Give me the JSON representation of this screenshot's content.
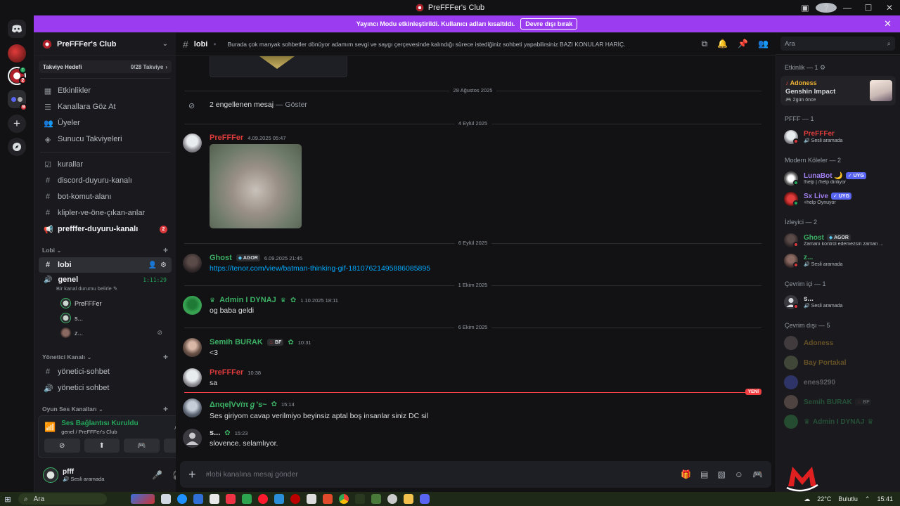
{
  "window": {
    "title": "PreFFFer's Club"
  },
  "banner": {
    "text": "Yayıncı Modu etkinleştirildi. Kullanıcı adları kısaltıldı.",
    "button": "Devre dışı bırak"
  },
  "sidebar": {
    "server_name": "PreFFFer's Club",
    "boost_label": "Takviye Hedefi",
    "boost_value": "0/28 Takviye",
    "nav": [
      {
        "label": "Etkinlikler",
        "icon": "calendar-icon"
      },
      {
        "label": "Kanallara Göz At",
        "icon": "browse-channels-icon"
      },
      {
        "label": "Üyeler",
        "icon": "members-icon"
      },
      {
        "label": "Sunucu Takviyeleri",
        "icon": "boost-icon"
      }
    ],
    "channels": [
      {
        "label": "kurallar",
        "icon": "rules-icon"
      },
      {
        "label": "discord-duyuru-kanalı",
        "icon": "hash-icon"
      },
      {
        "label": "bot-komut-alanı",
        "icon": "hash-icon"
      },
      {
        "label": "klipler-ve-öne-çıkan-anlar",
        "icon": "hash-icon"
      },
      {
        "label": "prefffer-duyuru-kanalı",
        "icon": "megaphone-icon",
        "badge": "2"
      }
    ],
    "category_lobi": "Lobi",
    "active_channel": "lobi",
    "voice_channel": {
      "name": "genel",
      "timer": "1:11:29",
      "status": "Bir kanal durumu belirle",
      "users": [
        "PreFFFer",
        "s...",
        "z..."
      ]
    },
    "category_admin": "Yönetici Kanalı",
    "admin_channels": [
      "yönetici-sohbet",
      "yönetici sohbet"
    ],
    "category_voice": "Oyun Ses Kanalları"
  },
  "voice_panel": {
    "title": "Ses Bağlantısı Kuruldu",
    "subtitle": "genel / PreFFFer's Club"
  },
  "user_panel": {
    "name": "pfff",
    "status": "Sesli aramada"
  },
  "chat": {
    "channel": "lobi",
    "topic": "Burada çok manyak sohbetler dönüyor adamım sevgi ve saygı çerçevesinde kalındığı sürece istediğiniz sohbeti yapabilirsiniz BAZI KONULAR HARİÇ.",
    "dividers": [
      "28 Ağustos 2025",
      "4 Eylül 2025",
      "6 Eylül 2025",
      "1 Ekim 2025",
      "6 Ekim 2025"
    ],
    "blocked_text": "2 engellenen mesaj",
    "blocked_show": "Göster",
    "messages": [
      {
        "author": "PreFFFer",
        "time": "4.09.2025 05:47",
        "body": ""
      },
      {
        "author": "Ghost",
        "tag": "AGOR",
        "time": "6.09.2025 21:45",
        "body": "https://tenor.com/view/batman-thinking-gif-18107621495886085895"
      },
      {
        "author": "Admin I DYNAJ",
        "time": "1.10.2025 18:11",
        "body": "og baba geldi"
      },
      {
        "author": "Semih BURAK",
        "tag": "BF",
        "time": "10:31",
        "body": "<3"
      },
      {
        "author": "PreFFFer",
        "time": "10:38",
        "body": "sa"
      },
      {
        "author": "ΔnqeļVvïπℊ's~",
        "time": "15:14",
        "body": "Ses giriyom cavap verilmiyo beyinsiz aptal boş insanlar siniz DC sil"
      },
      {
        "author": "s...",
        "time": "15:23",
        "body": "slovence. selamlıyor."
      }
    ],
    "new_label": "YENİ",
    "composer_placeholder": "#lobi kanalına mesaj gönder"
  },
  "search": {
    "placeholder": "Ara"
  },
  "members": {
    "activity_header": "Etkinlik — 1",
    "activity": {
      "name": "Adoness",
      "game": "Genshin Impact",
      "time": "2gün önce"
    },
    "groups": [
      {
        "header": "PFFF — 1",
        "members": [
          {
            "name": "PreFFFer",
            "status": "Sesli aramada",
            "color": "#e03c3c"
          }
        ]
      },
      {
        "header": "Modern Köleler — 2",
        "members": [
          {
            "name": "LunaBot 🌙",
            "tag": "UYG",
            "status": "!help | /help dinliyor",
            "color": "#a07ef0"
          },
          {
            "name": "Sx Live",
            "tag": "UYG",
            "status": "+help Oynuyor",
            "color": "#a07ef0"
          }
        ]
      },
      {
        "header": "İzleyici — 2",
        "members": [
          {
            "name": "Ghost",
            "tag": "AGOR",
            "status": "Zamanı kontrol edemezsin zaman ...",
            "color": "#3bb064"
          },
          {
            "name": "z...",
            "status": "Sesli aramada",
            "color": "#3bb064"
          }
        ]
      },
      {
        "header": "Çevrim içi — 1",
        "members": [
          {
            "name": "s...",
            "status": "Sesli aramada",
            "color": "#dbdee1"
          }
        ]
      },
      {
        "header": "Çevrim dışı — 5",
        "members": [
          {
            "name": "Adoness",
            "color": "#f0b232"
          },
          {
            "name": "Bay Portakal",
            "color": "#f0b232"
          },
          {
            "name": "enes9290",
            "color": "#dbdee1"
          },
          {
            "name": "Semih BURAK",
            "tag": "BF",
            "color": "#3bb064"
          },
          {
            "name": "Admin I DYNAJ",
            "color": "#3bb064"
          }
        ]
      }
    ]
  },
  "taskbar": {
    "search": "Ara",
    "weather": "22°C",
    "weather_desc": "Bulutlu",
    "clock": "15:41"
  },
  "colors": {
    "accent_banner": "#9b3cf0",
    "online": "#23a55a",
    "danger": "#da373c"
  }
}
